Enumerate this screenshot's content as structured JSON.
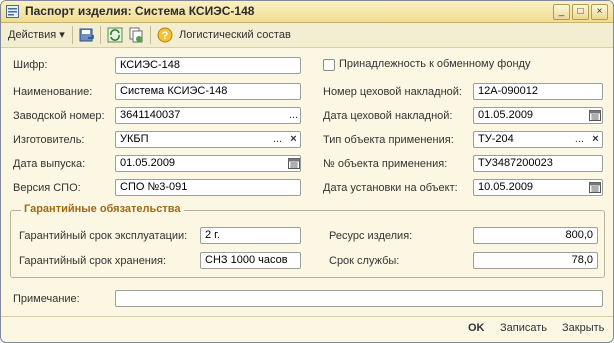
{
  "window": {
    "title": "Паспорт изделия: Система КСИЭС-148"
  },
  "titlebar_buttons": {
    "minimize": "_",
    "maximize": "□",
    "close": "×"
  },
  "toolbar": {
    "actions_label": "Действия ▾",
    "log_label": "Логистический состав"
  },
  "labels": {
    "cipher": "Шифр:",
    "name": "Наименование:",
    "factory_no": "Заводской номер:",
    "manufacturer": "Изготовитель:",
    "release_date": "Дата выпуска:",
    "spo_version": "Версия СПО:",
    "exchange_fund": "Принадлежность к обменному фонду",
    "shop_invoice_no": "Номер цеховой накладной:",
    "shop_invoice_date": "Дата цеховой накладной:",
    "object_type": "Тип объекта применения:",
    "object_no": "№ объекта применения:",
    "install_date": "Дата установки на объект:",
    "warranty_group": "Гарантийные обязательства",
    "warranty_operation": "Гарантийный срок эксплуатации:",
    "warranty_storage": "Гарантийный срок хранения:",
    "resource": "Ресурс изделия:",
    "service_life": "Срок службы:",
    "note": "Примечание:"
  },
  "values": {
    "cipher": "КСИЭС-148",
    "name": "Система КСИЭС-148",
    "factory_no": "3641140037",
    "manufacturer": "УКБП",
    "release_date": "01.05.2009",
    "spo_version": "СПО №3-091",
    "shop_invoice_no": "12А-090012",
    "shop_invoice_date": "01.05.2009",
    "object_type": "ТУ-204",
    "object_no": "ТУ3487200023",
    "install_date": "10.05.2009",
    "warranty_operation": "2 г.",
    "warranty_storage": "СНЗ 1000 часов",
    "resource": "800,0",
    "service_life": "78,0",
    "note": ""
  },
  "buttons": {
    "ok": "OK",
    "save": "Записать",
    "close": "Закрыть",
    "select": "...",
    "clear": "×"
  },
  "colors": {
    "title_bg": "#f1dd8e",
    "group_title": "#a06a16",
    "form_bg": "#fbf7e3"
  }
}
